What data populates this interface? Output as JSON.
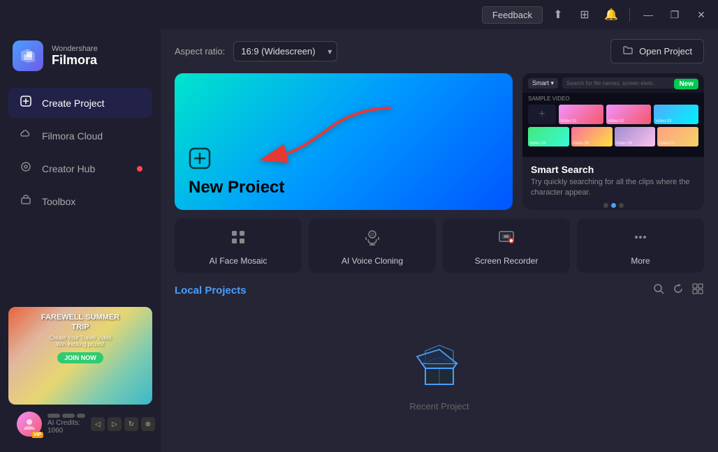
{
  "titleBar": {
    "feedback": "Feedback",
    "minimize": "—",
    "restore": "❐",
    "close": "✕"
  },
  "logo": {
    "brand": "Wondershare",
    "product": "Filmora"
  },
  "nav": {
    "items": [
      {
        "id": "create-project",
        "icon": "➕",
        "label": "Create Project",
        "active": true
      },
      {
        "id": "filmora-cloud",
        "icon": "☁",
        "label": "Filmora Cloud",
        "active": false
      },
      {
        "id": "creator-hub",
        "icon": "◎",
        "label": "Creator Hub",
        "active": false,
        "dot": true
      },
      {
        "id": "toolbox",
        "icon": "⊞",
        "label": "Toolbox",
        "active": false
      }
    ]
  },
  "promo": {
    "title": "FAREWELL SUMMER\nTRIP",
    "sub": "Create Your Travel Video\nWin exciting prizes!",
    "btn": "JOIN NOW"
  },
  "user": {
    "credits_label": "AI Credits: 1060",
    "vip": "VIP",
    "chevron": "›"
  },
  "toolbar": {
    "aspect_label": "Aspect ratio:",
    "aspect_value": "16:9 (Widescreen)",
    "open_project": "Open Project"
  },
  "newProject": {
    "label": "New Proiect"
  },
  "smartSearch": {
    "new_badge": "New",
    "top_bar_label": "Smart ▾",
    "search_placeholder": "Search for file names, screen elem...",
    "sample_label": "SAMPLE VIDEO",
    "title": "Smart Search",
    "desc": "Try quickly searching for all the clips where the character appear.",
    "video_labels": [
      "Video 01",
      "Video 02",
      "Video 03",
      "Video 04",
      "Video 05",
      "Video 06",
      "Video 07"
    ]
  },
  "quickActions": [
    {
      "id": "ai-face-mosaic",
      "icon": "⊞",
      "label": "AI Face Mosaic"
    },
    {
      "id": "ai-voice-cloning",
      "icon": "⊞",
      "label": "AI Voice Cloning"
    },
    {
      "id": "screen-recorder",
      "icon": "⊞",
      "label": "Screen Recorder"
    },
    {
      "id": "more",
      "icon": "···",
      "label": "More"
    }
  ],
  "localProjects": {
    "title": "Local Projects",
    "empty_text": "Recent Project"
  }
}
